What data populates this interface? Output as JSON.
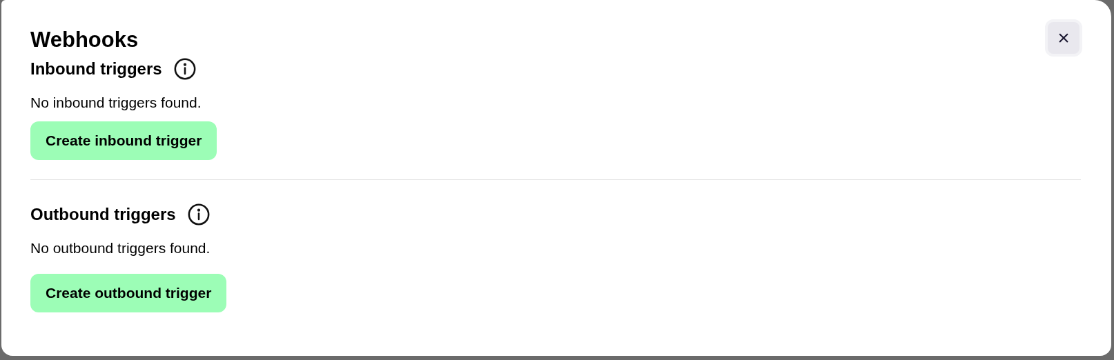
{
  "dialog": {
    "title": "Webhooks",
    "close_button": "×"
  },
  "sections": [
    {
      "heading": "Inbound triggers",
      "empty_message": "No inbound triggers found.",
      "button": "Create inbound trigger"
    },
    {
      "heading": "Outbound triggers",
      "empty_message": "No outbound triggers found.",
      "button": "Create outbound trigger"
    }
  ]
}
